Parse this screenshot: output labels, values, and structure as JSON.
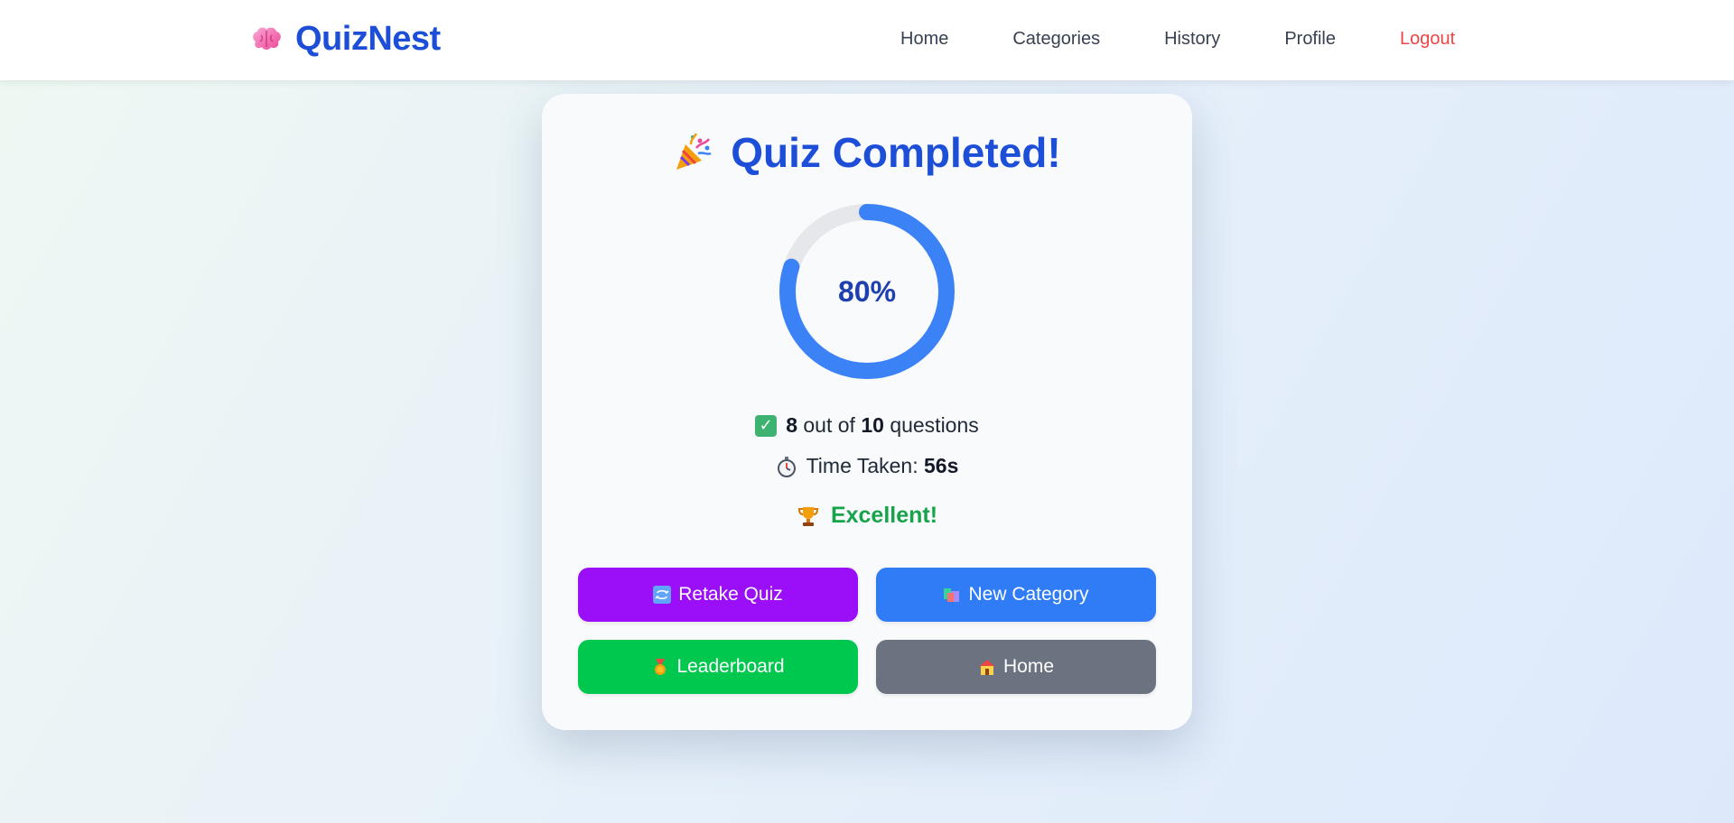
{
  "app": {
    "name": "QuizNest",
    "brand_icon": "brain-icon"
  },
  "nav": {
    "items": [
      {
        "label": "Home"
      },
      {
        "label": "Categories"
      },
      {
        "label": "History"
      },
      {
        "label": "Profile"
      },
      {
        "label": "Logout"
      }
    ]
  },
  "result": {
    "title": "Quiz Completed!",
    "title_icon": "party-popper-icon",
    "score_percent": 80,
    "score_label": "80%",
    "correct": "8",
    "total": "10",
    "out_of_text": "out of",
    "questions_text": "questions",
    "time_label": "Time Taken:",
    "time_value": "56s",
    "verdict": "Excellent!",
    "verdict_icon": "trophy-icon"
  },
  "actions": {
    "retake": "Retake Quiz",
    "new_category": "New Category",
    "leaderboard": "Leaderboard",
    "home": "Home"
  },
  "colors": {
    "brand": "#1d4ed8",
    "ring_progress": "#3b82f6",
    "ring_track": "#e5e7eb",
    "logout": "#ef4444",
    "excellent": "#16a34a",
    "retake_btn": "#9b0ff8",
    "new_category_btn": "#2f7cf6",
    "leaderboard_btn": "#00c84f",
    "home_btn": "#6b7280"
  }
}
